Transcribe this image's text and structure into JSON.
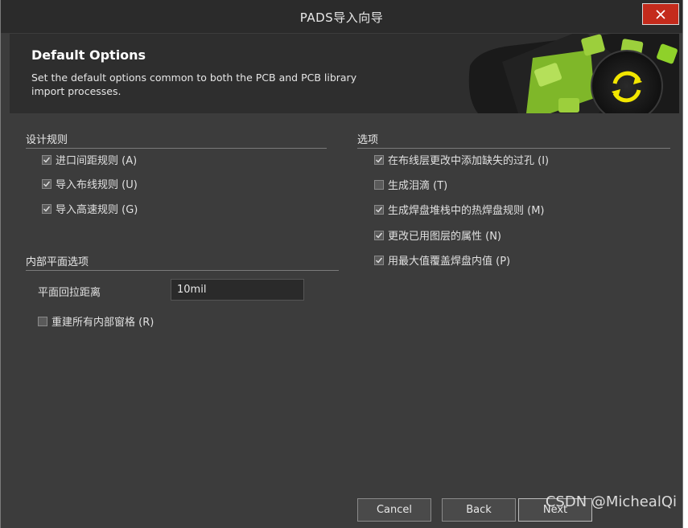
{
  "window": {
    "title": "PADS导入向导"
  },
  "banner": {
    "heading": "Default Options",
    "description": "Set the default options common to both the PCB and PCB library import processes."
  },
  "design_rules": {
    "title": "设计规则",
    "items": [
      {
        "label": "进口间距规则 (A)",
        "checked": true
      },
      {
        "label": "导入布线规则 (U)",
        "checked": true
      },
      {
        "label": "导入高速规则 (G)",
        "checked": true
      }
    ]
  },
  "inner_plane": {
    "title": "内部平面选项",
    "pullback_label": "平面回拉距离",
    "pullback_value": "10mil",
    "rebuild": {
      "label": "重建所有内部窗格 (R)",
      "checked": false
    }
  },
  "options": {
    "title": "选项",
    "items": [
      {
        "label": "在布线层更改中添加缺失的过孔 (I)",
        "checked": true
      },
      {
        "label": "生成泪滴 (T)",
        "checked": false
      },
      {
        "label": "生成焊盘堆栈中的热焊盘规则 (M)",
        "checked": true
      },
      {
        "label": "更改已用图层的属性 (N)",
        "checked": true
      },
      {
        "label": "用最大值覆盖焊盘内值 (P)",
        "checked": true
      }
    ]
  },
  "footer": {
    "cancel": "Cancel",
    "back": "Back",
    "next": "Next"
  },
  "watermark": "CSDN @MichealQi",
  "colors": {
    "close": "#c42b1c",
    "accent_green": "#8fd12a",
    "background": "#3c3c3c"
  }
}
